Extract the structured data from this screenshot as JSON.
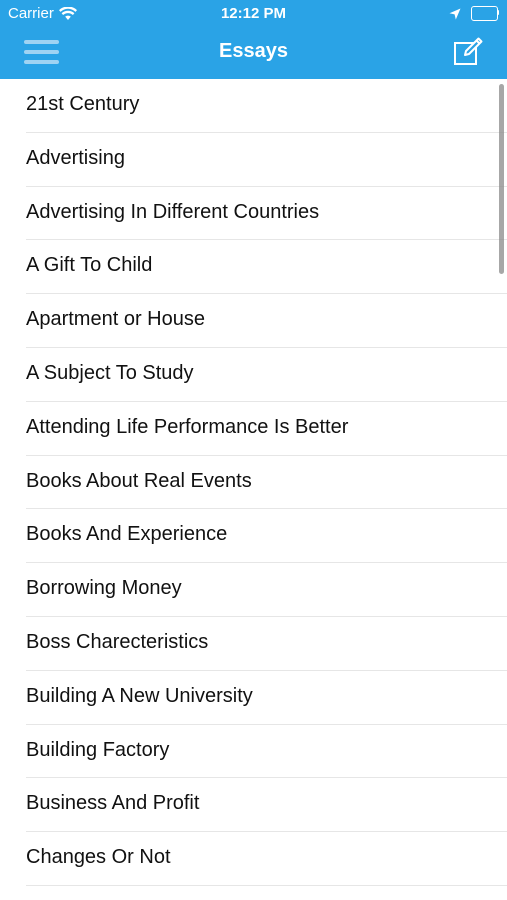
{
  "status_bar": {
    "carrier": "Carrier",
    "time": "12:12 PM",
    "icons": [
      "wifi-icon",
      "location-arrow-icon",
      "battery-icon"
    ]
  },
  "nav": {
    "title": "Essays",
    "left_icon": "hamburger-menu-icon",
    "right_icon": "compose-icon"
  },
  "colors": {
    "header_bg": "#2aa3e6",
    "menu_icon": "#9fd3f3",
    "text": "#111111",
    "divider": "#e6e6e6"
  },
  "essays": [
    "21st Century",
    "Advertising",
    "Advertising In Different Countries",
    "A Gift To Child",
    "Apartment or House",
    "A Subject To Study",
    "Attending Life Performance Is Better",
    "Books About Real Events",
    "Books And Experience",
    "Borrowing Money",
    "Boss Charecteristics",
    "Building A New University",
    "Building Factory",
    "Business And Profit",
    "Changes Or Not"
  ]
}
